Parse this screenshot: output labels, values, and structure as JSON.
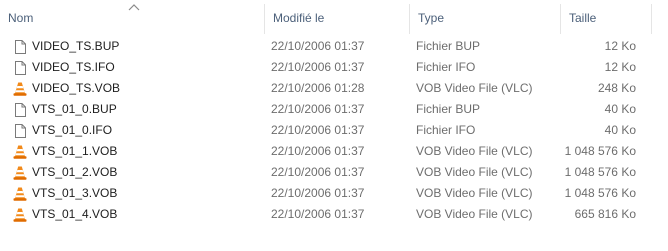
{
  "columns": {
    "name": "Nom",
    "modified": "Modifié le",
    "type": "Type",
    "size": "Taille"
  },
  "files": [
    {
      "name": "VIDEO_TS.BUP",
      "modified": "22/10/2006 01:37",
      "type": "Fichier BUP",
      "size": "12 Ko",
      "icon": "file-icon"
    },
    {
      "name": "VIDEO_TS.IFO",
      "modified": "22/10/2006 01:37",
      "type": "Fichier IFO",
      "size": "12 Ko",
      "icon": "file-icon"
    },
    {
      "name": "VIDEO_TS.VOB",
      "modified": "22/10/2006 01:28",
      "type": "VOB Video File (VLC)",
      "size": "248 Ko",
      "icon": "vlc-icon"
    },
    {
      "name": "VTS_01_0.BUP",
      "modified": "22/10/2006 01:37",
      "type": "Fichier BUP",
      "size": "40 Ko",
      "icon": "file-icon"
    },
    {
      "name": "VTS_01_0.IFO",
      "modified": "22/10/2006 01:37",
      "type": "Fichier IFO",
      "size": "40 Ko",
      "icon": "file-icon"
    },
    {
      "name": "VTS_01_1.VOB",
      "modified": "22/10/2006 01:37",
      "type": "VOB Video File (VLC)",
      "size": "1 048 576 Ko",
      "icon": "vlc-icon"
    },
    {
      "name": "VTS_01_2.VOB",
      "modified": "22/10/2006 01:37",
      "type": "VOB Video File (VLC)",
      "size": "1 048 576 Ko",
      "icon": "vlc-icon"
    },
    {
      "name": "VTS_01_3.VOB",
      "modified": "22/10/2006 01:37",
      "type": "VOB Video File (VLC)",
      "size": "1 048 576 Ko",
      "icon": "vlc-icon"
    },
    {
      "name": "VTS_01_4.VOB",
      "modified": "22/10/2006 01:37",
      "type": "VOB Video File (VLC)",
      "size": "665 816 Ko",
      "icon": "vlc-icon"
    }
  ]
}
